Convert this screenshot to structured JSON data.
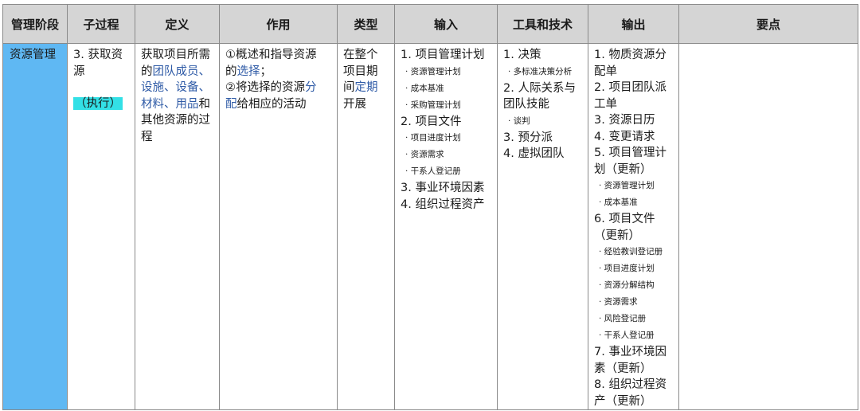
{
  "headers": [
    "管理阶段",
    "子过程",
    "定义",
    "作用",
    "类型",
    "输入",
    "工具和技术",
    "输出",
    "要点"
  ],
  "row": {
    "stage": "资源管理",
    "subprocess": {
      "line1": "3.  获取资",
      "line2": "源",
      "tag": "（执行）"
    },
    "definition": {
      "l1": "获取项目所需",
      "l2a": "的",
      "l2b": "团队成员、",
      "l3": "设施、设备、",
      "l4a": "材料、用品",
      "l4b": "和",
      "l5": "其他资源的过",
      "l6": "程"
    },
    "purpose": {
      "l1": "①概述和指导资源",
      "l2a": "的",
      "l2b": "选择",
      "l2c": "；",
      "l3a": "②将选择的资源",
      "l3b": "分",
      "l4a": "配",
      "l4b": "给相应的活动"
    },
    "type": {
      "l1": "在整个",
      "l2": "项目期",
      "l3a": "间",
      "l3b": "定期",
      "l4": "开展"
    },
    "inputs": {
      "i1": "1. 项目管理计划",
      "i1_subs": [
        "· 资源管理计划",
        "· 成本基准",
        "· 采购管理计划"
      ],
      "i2": "2. 项目文件",
      "i2_subs": [
        "· 项目进度计划",
        "· 资源需求",
        "· 干系人登记册"
      ],
      "i3": "3. 事业环境因素",
      "i4": "4. 组织过程资产"
    },
    "tools": {
      "t1": "1. 决策",
      "t1_sub": "· 多标准决策分析",
      "t2a": "2. 人际关系与",
      "t2b": "团队技能",
      "t2_sub": "· 谈判",
      "t3": "3. 预分派",
      "t4": "4. 虚拟团队"
    },
    "outputs": {
      "o1a": "1. 物质资源分",
      "o1b": "配单",
      "o2a": "2. 项目团队派",
      "o2b": "工单",
      "o3": "3. 资源日历",
      "o4": "4. 变更请求",
      "o5a": "5. 项目管理计",
      "o5b": "划（更新）",
      "o5_subs": [
        "· 资源管理计划",
        "· 成本基准"
      ],
      "o6a": "6. 项目文件",
      "o6b": "（更新）",
      "o6_subs": [
        "· 经验教训登记册",
        "· 项目进度计划",
        "· 资源分解结构",
        "· 资源需求",
        "· 风险登记册",
        "· 干系人登记册"
      ],
      "o7a": "7. 事业环境因",
      "o7b": "素（更新）",
      "o8a": "8. 组织过程资",
      "o8b": "产（更新）"
    },
    "notes": ""
  },
  "colors": {
    "header_bg": "#d5d5d5",
    "stage_bg": "#5fb8f3",
    "highlight": "#33e0e6",
    "link_blue": "#2e5aa6"
  }
}
